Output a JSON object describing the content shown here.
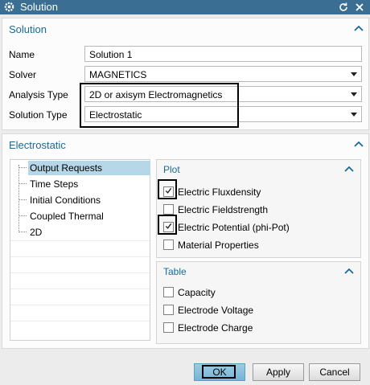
{
  "window": {
    "title": "Solution"
  },
  "solution_group": {
    "title": "Solution",
    "fields": [
      {
        "label": "Name",
        "value": "Solution 1"
      },
      {
        "label": "Solver",
        "value": "MAGNETICS"
      },
      {
        "label": "Analysis Type",
        "value": "2D or axisym Electromagnetics"
      },
      {
        "label": "Solution Type",
        "value": "Electrostatic"
      }
    ]
  },
  "electrostatic_group": {
    "title": "Electrostatic",
    "tree": [
      {
        "label": "Output Requests",
        "selected": true
      },
      {
        "label": "Time Steps"
      },
      {
        "label": "Initial Conditions"
      },
      {
        "label": "Coupled Thermal"
      },
      {
        "label": "2D"
      }
    ],
    "plot": {
      "title": "Plot",
      "items": [
        {
          "label": "Electric Fluxdensity",
          "checked": true
        },
        {
          "label": "Electric Fieldstrength",
          "checked": false
        },
        {
          "label": "Electric Potential (phi-Pot)",
          "checked": true
        },
        {
          "label": "Material Properties",
          "checked": false
        }
      ]
    },
    "table": {
      "title": "Table",
      "items": [
        {
          "label": "Capacity",
          "checked": false
        },
        {
          "label": "Electrode Voltage",
          "checked": false
        },
        {
          "label": "Electrode Charge",
          "checked": false
        }
      ]
    }
  },
  "buttons": {
    "ok": "OK",
    "apply": "Apply",
    "cancel": "Cancel"
  },
  "colors": {
    "titlebar": "#3a6e92",
    "accent": "#1a6b96",
    "selection": "#b5d7e8",
    "primary_button": "#85bfdd"
  }
}
